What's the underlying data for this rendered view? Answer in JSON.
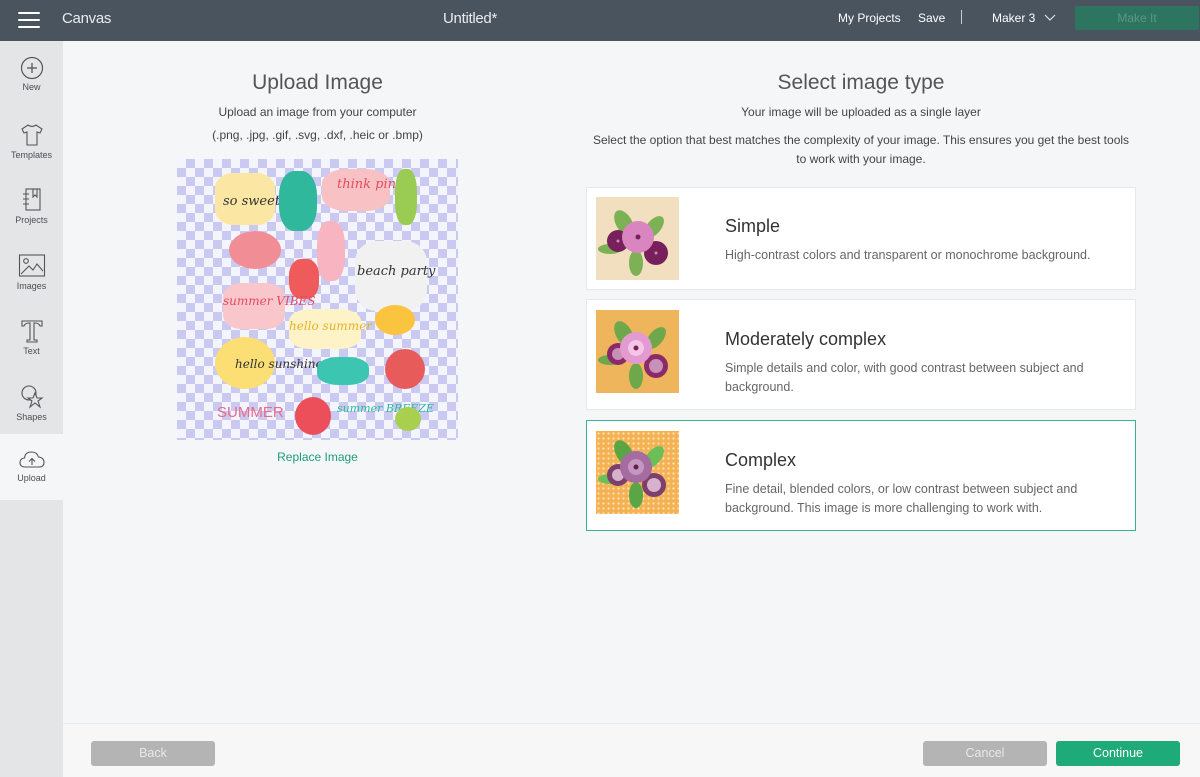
{
  "topbar": {
    "app_title": "Canvas",
    "doc_title": "Untitled*",
    "my_projects": "My Projects",
    "save": "Save",
    "separator": "|",
    "machine": "Maker 3",
    "make_it": "Make It",
    "accent_color": "#2d7560"
  },
  "sidebar": {
    "items": [
      {
        "label": "New",
        "icon": "plus-circle-icon"
      },
      {
        "label": "Templates",
        "icon": "tshirt-icon"
      },
      {
        "label": "Projects",
        "icon": "notebook-icon"
      },
      {
        "label": "Images",
        "icon": "image-icon"
      },
      {
        "label": "Text",
        "icon": "text-t-icon"
      },
      {
        "label": "Shapes",
        "icon": "shapes-icon"
      },
      {
        "label": "Upload",
        "icon": "cloud-upload-icon",
        "active": true
      }
    ]
  },
  "upload": {
    "title": "Upload Image",
    "subtitle": "Upload an image from your computer",
    "formats": "(.png, .jpg, .gif, .svg, .dxf, .heic or .bmp)",
    "preview_stickers": [
      "so sweet",
      "think pink",
      "beach party",
      "summer VIBES",
      "hello summer",
      "hello sunshine",
      "SUMMER",
      "summer BREEZE"
    ],
    "replace_label": "Replace Image"
  },
  "image_type": {
    "title": "Select image type",
    "subtitle": "Your image will be uploaded as a single layer",
    "instructions": "Select the option that best matches the complexity of your image. This ensures you get the best tools to work with your image.",
    "options": [
      {
        "title": "Simple",
        "description": "High-contrast colors and transparent or monochrome background.",
        "thumb_bg": "#f1dfc0",
        "selected": false
      },
      {
        "title": "Moderately complex",
        "description": "Simple details and color, with good contrast between subject and background.",
        "thumb_bg": "#eeb55c",
        "selected": false
      },
      {
        "title": "Complex",
        "description": "Fine detail, blended colors, or low contrast between subject and background. This image is more challenging to work with.",
        "thumb_bg": "#f4b253",
        "selected": true
      }
    ],
    "selected_border_color": "#3cb290"
  },
  "footer": {
    "back": "Back",
    "cancel": "Cancel",
    "continue": "Continue",
    "continue_color": "#1faa7a"
  }
}
